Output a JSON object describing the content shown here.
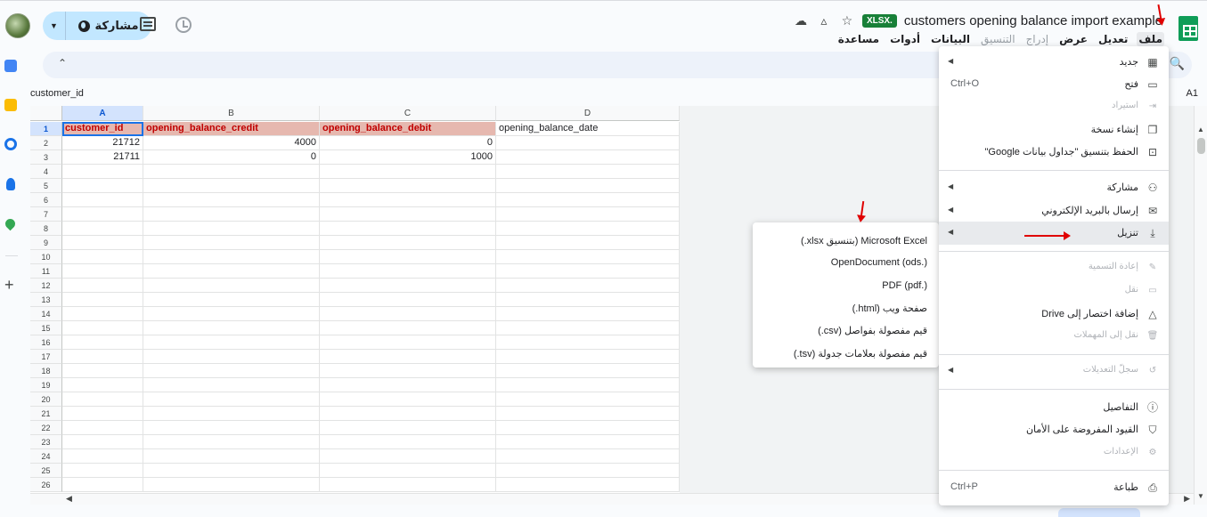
{
  "header": {
    "doc_title": "customers opening balance import example",
    "format_badge": "XLSX.",
    "share_label": "مشاركة"
  },
  "menubar": [
    {
      "label": "ملف",
      "active": true
    },
    {
      "label": "تعديل"
    },
    {
      "label": "عرض"
    },
    {
      "label": "إدراج",
      "dim": true
    },
    {
      "label": "التنسيق",
      "dim": true
    },
    {
      "label": "البيانات"
    },
    {
      "label": "أدوات"
    },
    {
      "label": "مساعدة"
    }
  ],
  "formula_bar": {
    "value": "customer_id",
    "cell_ref": "A1"
  },
  "sheet": {
    "columns": [
      "A",
      "B",
      "C",
      "D"
    ],
    "rows": [
      "1",
      "2",
      "3",
      "4",
      "5",
      "6",
      "7",
      "8",
      "9",
      "10",
      "11",
      "12",
      "13",
      "14",
      "15",
      "16",
      "17",
      "18",
      "19",
      "20",
      "21",
      "22",
      "23",
      "24",
      "25",
      "26"
    ],
    "headers": [
      "customer_id",
      "opening_balance_credit",
      "opening_balance_debit",
      "opening_balance_date"
    ],
    "data": [
      [
        "21712",
        "4000",
        "0",
        ""
      ],
      [
        "21711",
        "0",
        "1000",
        ""
      ]
    ]
  },
  "file_menu": {
    "items": [
      {
        "label": "جديد",
        "icon": "new-sheet-icon",
        "submenu": true
      },
      {
        "label": "فتح",
        "icon": "folder-icon",
        "shortcut": "Ctrl+O"
      },
      {
        "label": "استيراد",
        "icon": "import-icon",
        "disabled": true
      },
      {
        "label": "إنشاء نسخة",
        "icon": "copy-icon"
      },
      {
        "label": "الحفظ بتنسيق \"جداول بيانات Google\"",
        "icon": "save-icon"
      },
      {
        "label": "مشاركة",
        "icon": "person-add-icon",
        "submenu": true
      },
      {
        "label": "إرسال بالبريد الإلكتروني",
        "icon": "mail-icon",
        "submenu": true
      },
      {
        "label": "تنزيل",
        "icon": "download-icon",
        "submenu": true,
        "highlighted": true
      },
      {
        "label": "إعادة التسمية",
        "icon": "pencil-icon",
        "disabled": true
      },
      {
        "label": "نقل",
        "icon": "move-folder-icon",
        "disabled": true
      },
      {
        "label": "إضافة اختصار إلى Drive",
        "icon": "drive-shortcut-icon"
      },
      {
        "label": "نقل إلى المهملات",
        "icon": "trash-icon",
        "disabled": true
      },
      {
        "label": "سجلّ التعديلات",
        "icon": "history-icon",
        "submenu": true,
        "disabled": true
      },
      {
        "label": "التفاصيل",
        "icon": "info-icon"
      },
      {
        "label": "القيود المفروضة على الأمان",
        "icon": "shield-icon"
      },
      {
        "label": "الإعدادات",
        "icon": "settings-icon",
        "disabled": true
      },
      {
        "label": "طباعة",
        "icon": "print-icon",
        "shortcut": "Ctrl+P"
      }
    ]
  },
  "download_submenu": [
    "Microsoft Excel (بتنسيق xlsx.)",
    "OpenDocument (ods.)",
    "PDF (pdf.)",
    "صفحة ويب (html.)",
    "قيم مفصولة بفواصل (csv.)",
    "قيم مفصولة بعلامات جدولة (tsv.)"
  ],
  "colors": {
    "accent": "#0b57d0",
    "header_fill": "#e6b8af",
    "header_text": "#c00000",
    "annotation": "#e00000"
  }
}
